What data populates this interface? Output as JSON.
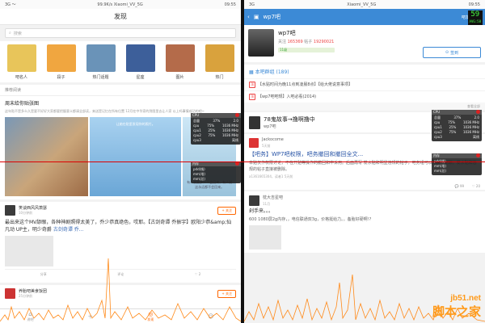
{
  "colors": {
    "accent_left": "#ff6600",
    "accent_right": "#3c8ad6",
    "link": "#3a6bb5",
    "overlay_line": "#dd0000",
    "watermark": "#ff9a1a"
  },
  "left": {
    "status": {
      "left": "3G 〜",
      "center": "99.9K/s  Xiaomi_VV_5G",
      "right": "09:55"
    },
    "title": "发现",
    "search_placeholder": "搜索",
    "categories": [
      {
        "label": "吧名人",
        "color": "#e8c55a"
      },
      {
        "label": "段子",
        "color": "#f0a640"
      },
      {
        "label": "热门话题",
        "color": "#6a93b8"
      },
      {
        "label": "星座",
        "color": "#3d5f9a"
      },
      {
        "label": "图片",
        "color": "#b46b4a"
      },
      {
        "label": "热门",
        "color": "#d9a23d"
      }
    ],
    "section_label": "推荐阅读",
    "topic": {
      "title": "周末给你贴张图",
      "desc": "这年贴不是多么久是要不好好大家都要把握意义都请全部读，来送是记忆在所有位置 12月在中华家的到图里去让人家 以上吗事情成功的吧~"
    },
    "photo_caption_2": "让她在贴里发现你的照片。",
    "photo_caption_3": "有人说要多少个会回来，有人说这永远都不会回来。",
    "post": {
      "name": "笑谈西风风萧瑟",
      "meta": "10分钟前",
      "follow": "+ 关注",
      "text": "最出来这个MV舔眼，各种神剧照得太美了，乔少恭真绝色，哎耶。【古剑奇谭 乔振宇】欧阳少恭&amp;仙凡动  UP主，明少奇爵",
      "link_text": "古剑奇谭 乔...",
      "actions": [
        "分享",
        "评论",
        "2"
      ]
    },
    "post2": {
      "name": "养胎吧美食饭团",
      "meta": "25分钟前",
      "follow": "+ 关注"
    },
    "tabs": [
      "进吧",
      "",
      "发现",
      ""
    ]
  },
  "right": {
    "status": {
      "left": "3G",
      "center": "Xiaomi_VV_5G",
      "right": "09:55"
    },
    "title": "wp7吧",
    "header_actions": [
      "吧友",
      "直播"
    ],
    "bar": {
      "name": "wp7吧",
      "followers_label": "关注",
      "followers": "165369",
      "posts_label": "帖子",
      "posts": "19290021",
      "level": "11级",
      "sign_label": "签到"
    },
    "group_label": "本吧群组 (189)",
    "notices": [
      "【水贴时间为晚11点到凌晨8点】【给大佬说意事项】",
      "【wp7吧吧规】入吧必看(2014)"
    ],
    "sort_label": "查看全部",
    "thread1": {
      "title": "78鬼故事→撸啊撸中",
      "author": "wp7吧",
      "replies": "1"
    },
    "thread2": {
      "author": "Jackocome",
      "time": "5天前",
      "title": "【吧务】WP7吧权限，吧务撤回和撤回全文...",
      "summary": "本贴仅作权限讨论，不在开贴等操作的撤回和申诉用。后面再写 发水贴和明显违规的帖子，吧务组可以无条件删除，发水贴和违规的帖子直接被删除。",
      "meta": "a1361665304，读者1  5天前"
    },
    "foot": [
      "99",
      "20"
    ],
    "thread3": {
      "author": "枕大吉星吧",
      "time": "11月",
      "text": "剁手来。。。",
      "sub": "600 1080屏2g内存，，电信联通双3g，价格挺给力。。备胎好硬啊!?"
    }
  },
  "overlay": {
    "fps": "59",
    "fps_sub": "AVG:58",
    "cpu_title": "CPU",
    "rows": [
      [
        "总量",
        "37%",
        "2.0"
      ],
      [
        "cpu",
        "75%",
        "1036 MHz"
      ],
      [
        "cpu1",
        "25%",
        "1036 MHz"
      ],
      [
        "cpu2",
        "75%",
        "1036 MHz"
      ],
      [
        "cpu3",
        "",
        "离线"
      ]
    ],
    "mem_title": "内存",
    "mem_rows": [
      [
        "pdd(栈)",
        ""
      ],
      [
        "mm(堆)",
        ""
      ],
      [
        "mm(总)",
        ""
      ]
    ]
  },
  "watermark": {
    "url": "jb51.net",
    "name": "脚本之家"
  }
}
